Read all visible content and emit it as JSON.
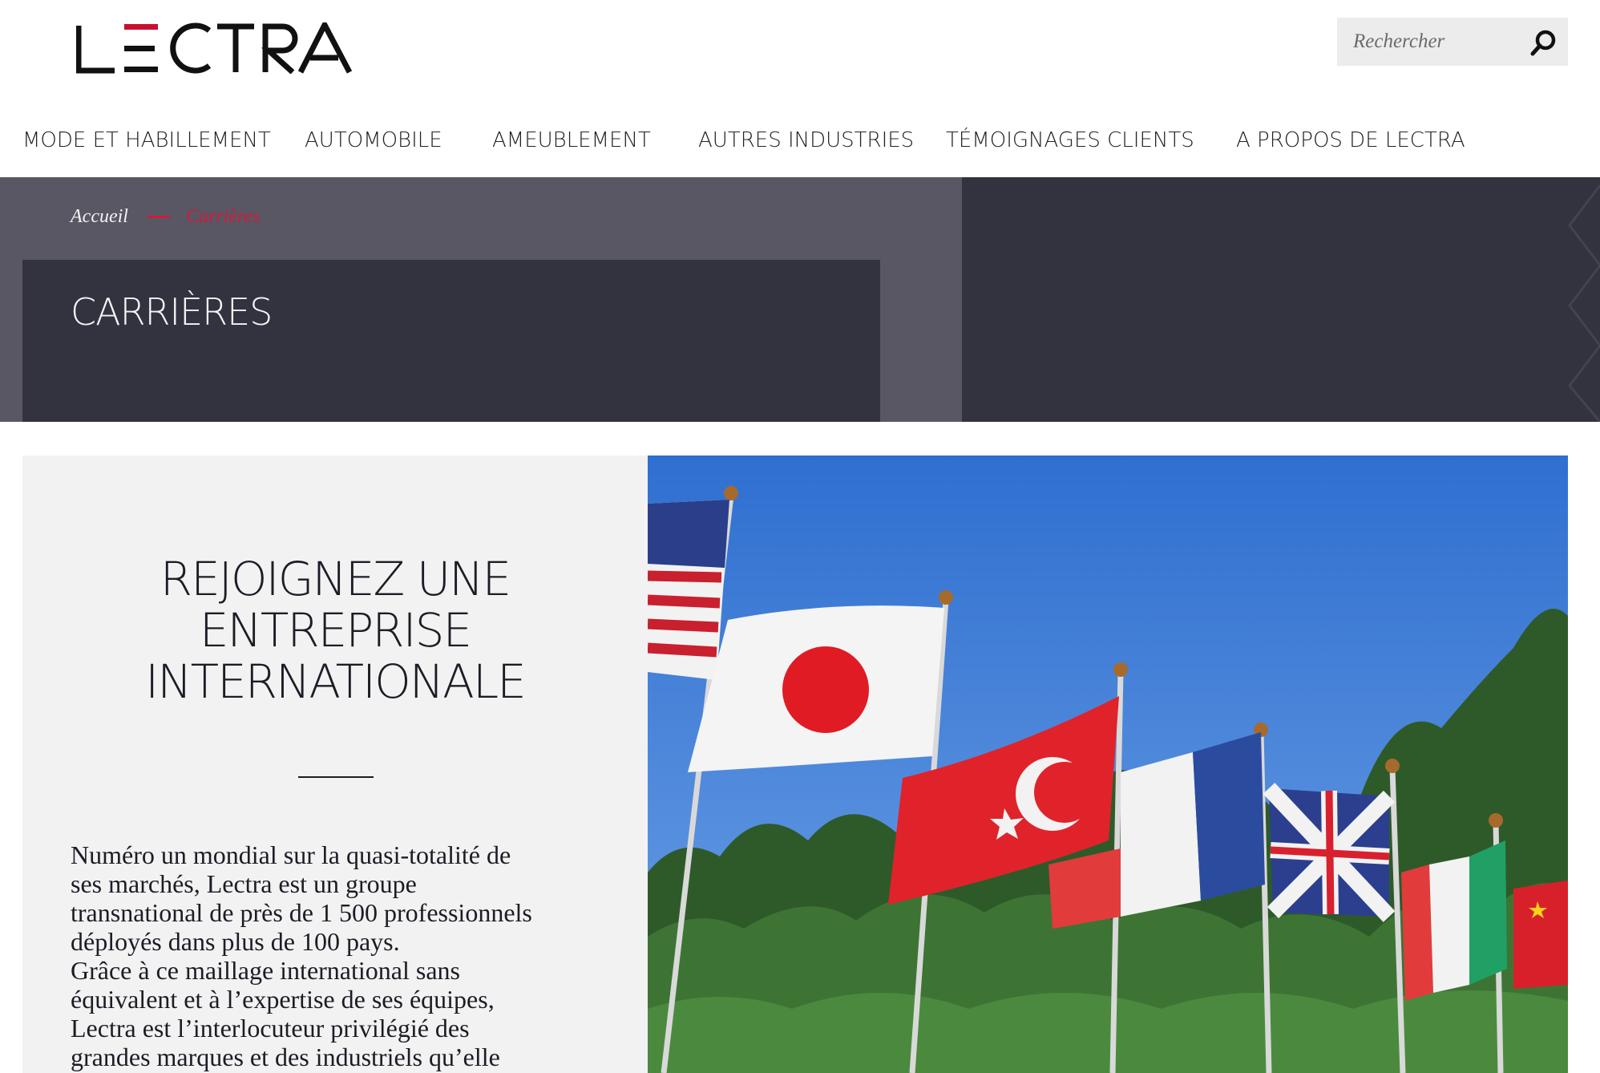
{
  "header": {
    "logo_text": "LECTRA",
    "search_placeholder": "Rechercher"
  },
  "nav": [
    {
      "label": "MODE ET HABILLEMENT"
    },
    {
      "label": "AUTOMOBILE"
    },
    {
      "label": "AMEUBLEMENT"
    },
    {
      "label": "AUTRES INDUSTRIES"
    },
    {
      "label": "TÉMOIGNAGES CLIENTS"
    },
    {
      "label": "A PROPOS DE LECTRA"
    }
  ],
  "breadcrumb": {
    "home": "Accueil",
    "current": "Carrières"
  },
  "page_title": "CARRIÈRES",
  "section": {
    "heading": "REJOIGNEZ UNE ENTREPRISE INTERNATIONALE",
    "body_lines": [
      "Numéro un mondial sur la quasi-totalité de",
      "ses marchés, Lectra est un groupe",
      "transnational de près de 1 500 professionnels",
      "déployés dans plus de 100 pays.",
      "Grâce à ce maillage international sans",
      "équivalent et à l’expertise de ses équipes,",
      "Lectra est l’interlocuteur privilégié des",
      "grandes marques et des industriels qu’elle"
    ]
  },
  "colors": {
    "accent": "#c8102e",
    "hero_dark": "#33323f",
    "hero_light": "#595764",
    "panel_bg": "#f2f2f2",
    "sky": "#3f7ed6"
  }
}
